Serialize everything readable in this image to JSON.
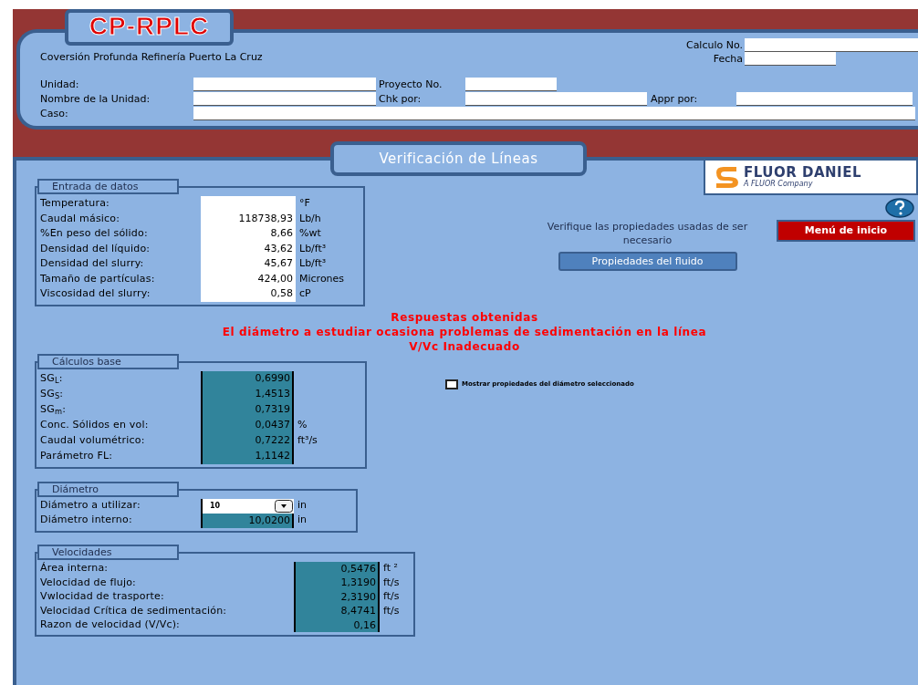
{
  "app_title": "CP-RPLC",
  "header": {
    "company": "Coversión Profunda Refinería Puerto La Cruz",
    "calculo_no": {
      "label": "Calculo No."
    },
    "fecha": {
      "label": "Fecha"
    },
    "unidad": {
      "label": "Unidad:"
    },
    "proyecto_no": {
      "label": "Proyecto No."
    },
    "nombre_unidad": {
      "label": "Nombre de la Unidad:"
    },
    "chk_por": {
      "label": "Chk por:"
    },
    "appr_por": {
      "label": "Appr por:"
    },
    "caso": {
      "label": "Caso:"
    }
  },
  "page_title": "Verificación de Líneas",
  "logo": {
    "name": "FLUOR DANIEL",
    "tagline": "A FLUOR Company"
  },
  "menu_button": "Menú de inicio",
  "verify_note": "Verifique las propiedades usadas de ser necesario",
  "fluid_button": "Propiedades del fluido",
  "results": [
    "Respuestas obtenidas",
    "El diámetro a estudiar ocasiona problemas de sedimentación en la línea",
    "V/Vc Inadecuado"
  ],
  "show_properties": {
    "label": "Mostrar propiedades del diámetro seleccionado",
    "checked": false
  },
  "sections": [
    {
      "title": "Entrada de datos",
      "rows": [
        {
          "label": "Temperatura:",
          "kind": "input",
          "unit": "°F"
        },
        {
          "label": "Caudal másico:",
          "kind": "input",
          "value": "118738,93",
          "unit": "Lb/h"
        },
        {
          "label": "%En peso del sólido:",
          "kind": "input",
          "value": "8,66",
          "unit": "%wt"
        },
        {
          "label": "Densidad del líquido:",
          "kind": "input",
          "value": "43,62",
          "unit": "Lb/ft³"
        },
        {
          "label": "Densidad del slurry:",
          "kind": "input",
          "value": "45,67",
          "unit": "Lb/ft³"
        },
        {
          "label": "Tamaño de partículas:",
          "kind": "input",
          "value": "424,00",
          "unit": "Micrones"
        },
        {
          "label": "Viscosidad del slurry:",
          "kind": "input",
          "value": "0,58",
          "unit": "cP"
        }
      ]
    },
    {
      "title": "Cálculos base",
      "rows": [
        {
          "label": "SG$_{L}$:",
          "kind": "output",
          "value": "0,6990"
        },
        {
          "label": "SG$_{S}$:",
          "kind": "output",
          "value": "1,4513"
        },
        {
          "label": "SG$_{m}$:",
          "kind": "output",
          "value": "0,7319"
        },
        {
          "label": "Conc. Sólidos en vol:",
          "kind": "output",
          "value": "0,0437",
          "unit": "%"
        },
        {
          "label": "Caudal volumétrico:",
          "kind": "output",
          "value": "0,7222",
          "unit": "ft³/s"
        },
        {
          "label": "Parámetro FL:",
          "kind": "output",
          "value": "1,1142"
        }
      ]
    },
    {
      "title": "Diámetro",
      "rows": [
        {
          "label": "Diámetro a utilizar:",
          "kind": "dropdown",
          "value": "10",
          "unit": "in"
        },
        {
          "label": "Diámetro interno:",
          "kind": "output",
          "value": "10,0200",
          "unit": "in"
        }
      ]
    },
    {
      "title": "Velocidades",
      "rows": [
        {
          "label": "Área interna:",
          "kind": "output",
          "value": "0,5476",
          "unit": "ft ²"
        },
        {
          "label": "Velocidad de flujo:",
          "kind": "output",
          "value": "1,3190",
          "unit": "ft/s"
        },
        {
          "label": "Vwlocidad de trasporte:",
          "kind": "output",
          "value": "2,3190",
          "unit": "ft/s"
        },
        {
          "label": "Velocidad Crítica de sedimentación:",
          "kind": "output",
          "value": "8,4741",
          "unit": "ft/s"
        },
        {
          "label": "Razon de velocidad (V/Vc):",
          "kind": "output",
          "value": "0,16"
        }
      ]
    }
  ]
}
